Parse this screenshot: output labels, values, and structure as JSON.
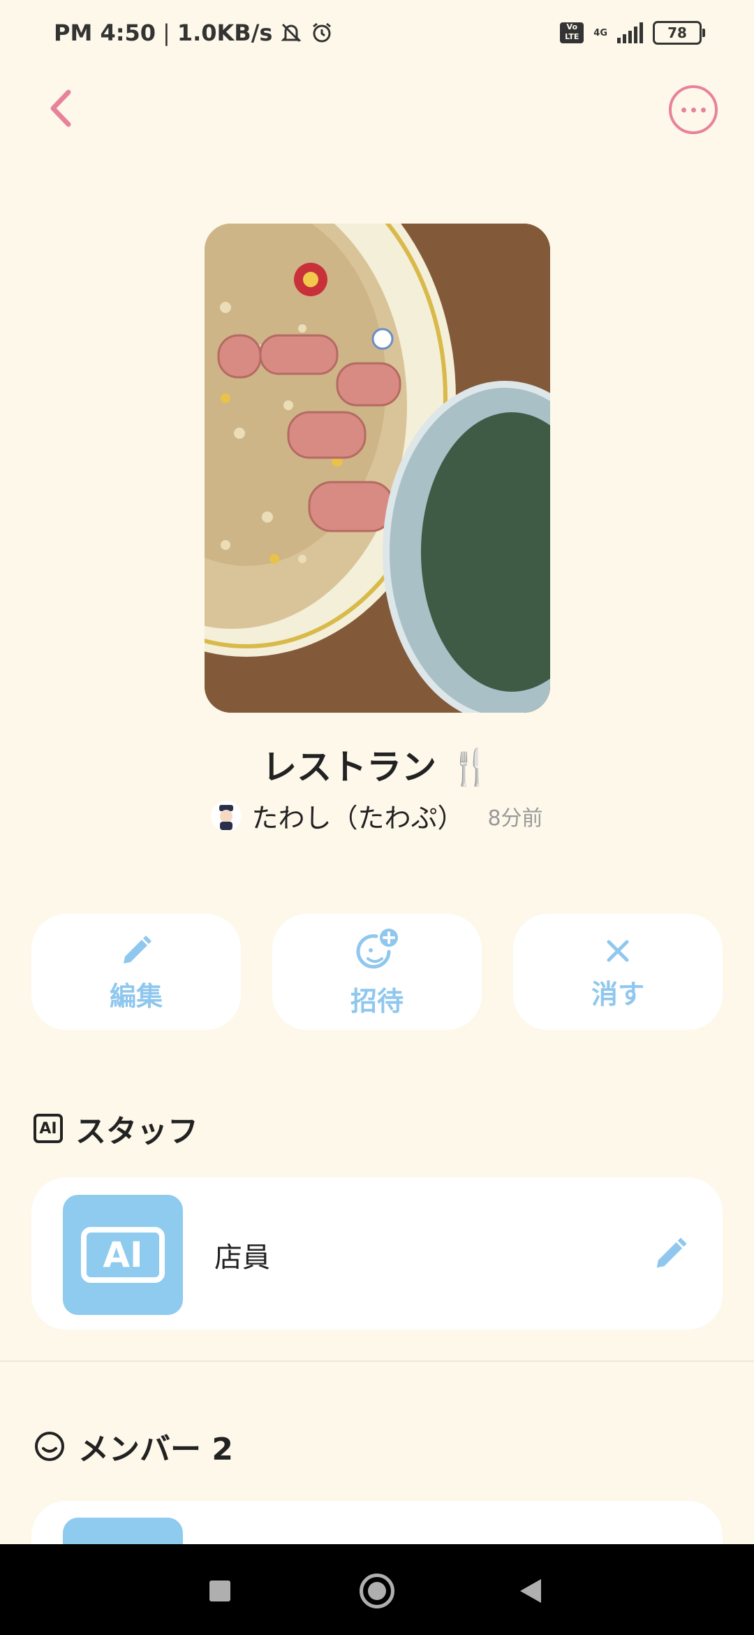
{
  "status_bar": {
    "time": "PM 4:50",
    "speed": "1.0KB/s",
    "volte": "Vo LTE",
    "network": "4G",
    "battery": "78"
  },
  "room": {
    "title": "レストラン",
    "emoji": "🍴",
    "author": "たわし（たわぷ）",
    "time_ago": "8分前"
  },
  "actions": {
    "edit": "編集",
    "invite": "招待",
    "delete": "消す"
  },
  "staff_section": {
    "badge": "AI",
    "title": "スタッフ",
    "staff": [
      {
        "avatar_text": "AI",
        "name": "店員"
      }
    ]
  },
  "member_section": {
    "title": "メンバー 2"
  },
  "colors": {
    "background": "#FDF8EA",
    "accent_pink": "#E8829A",
    "accent_blue": "#8FC7EE"
  }
}
